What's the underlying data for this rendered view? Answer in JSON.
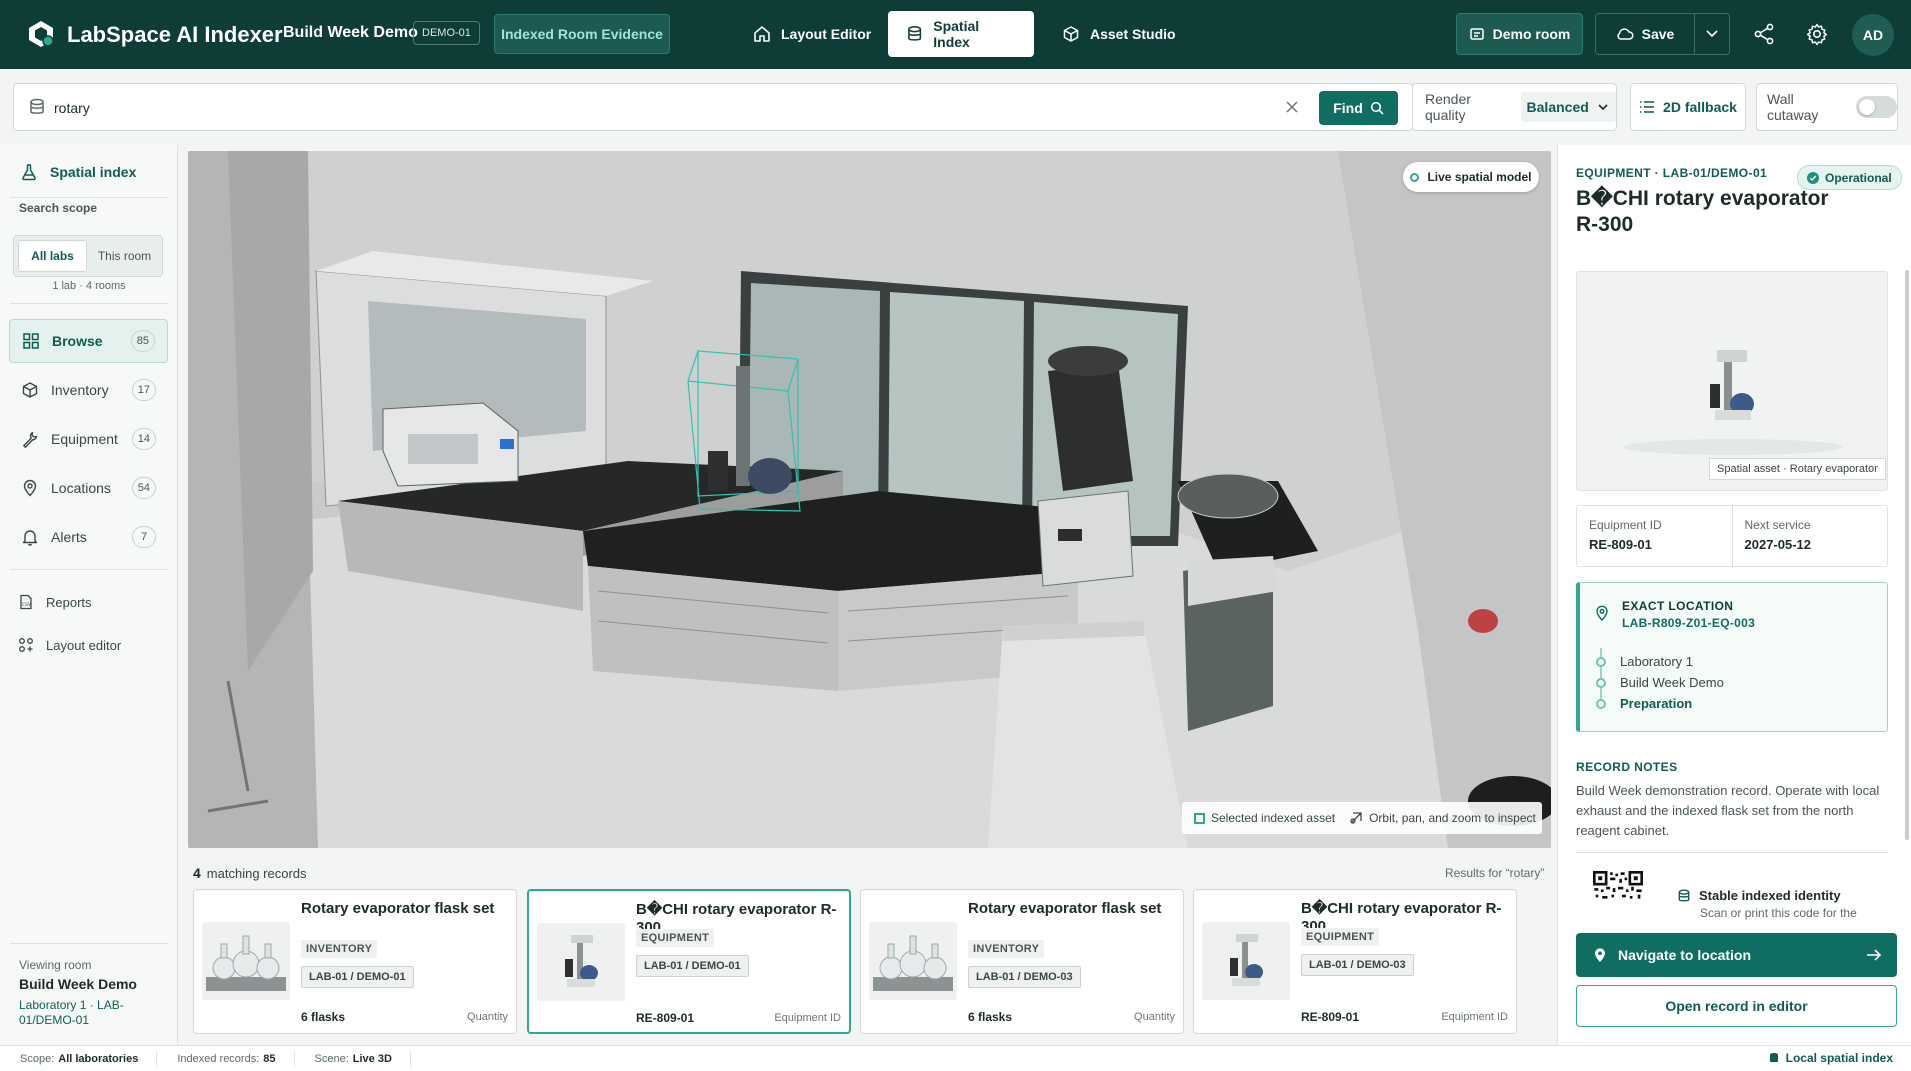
{
  "app": {
    "title": "LabSpace AI Indexer",
    "project": "Build Week Demo",
    "project_badge": "DEMO-01",
    "evidence_button": "Indexed Room Evidence",
    "avatar": "AD",
    "colors": {
      "brand": "#0e3d38",
      "accent": "#0f6d62",
      "highlight": "#2ea793"
    }
  },
  "nav": {
    "tabs": [
      {
        "label": "Layout Editor",
        "icon": "home-icon"
      },
      {
        "label": "Spatial Index",
        "icon": "database-icon",
        "active": true
      },
      {
        "label": "Asset Studio",
        "icon": "cube-icon"
      }
    ],
    "demo_room": "Demo room",
    "save": "Save"
  },
  "search": {
    "value": "rotary",
    "find_label": "Find",
    "quality_label": "Render quality",
    "quality_value": "Balanced",
    "fallback_label": "2D fallback",
    "cutaway_label": "Wall cutaway",
    "cutaway_on": false
  },
  "sidebar": {
    "title": "Spatial index",
    "scope_label": "Search scope",
    "scope_options": [
      "All labs",
      "This room"
    ],
    "scope_meta": "1 lab · 4 rooms",
    "items": [
      {
        "label": "Browse",
        "count": "85",
        "icon": "grid-icon",
        "active": true
      },
      {
        "label": "Inventory",
        "count": "17",
        "icon": "box-icon"
      },
      {
        "label": "Equipment",
        "count": "14",
        "icon": "wrench-icon"
      },
      {
        "label": "Locations",
        "count": "54",
        "icon": "pin-icon"
      },
      {
        "label": "Alerts",
        "count": "7",
        "icon": "bell-icon"
      }
    ],
    "sub_items": [
      {
        "label": "Reports",
        "icon": "csv-icon"
      },
      {
        "label": "Layout editor",
        "icon": "layout-icon"
      }
    ],
    "viewing_label": "Viewing room",
    "viewing_room": "Build Week Demo",
    "viewing_path": "Laboratory 1 · LAB-01/DEMO-01"
  },
  "viewport": {
    "live_label": "Live spatial model",
    "legend_selected": "Selected indexed asset",
    "legend_hint": "Orbit, pan, and zoom to inspect"
  },
  "results": {
    "count": "4",
    "count_label": "matching records",
    "query_note": "Results for “rotary”",
    "cards": [
      {
        "title": "Rotary evaporator flask set",
        "category": "INVENTORY",
        "location": "LAB-01 / DEMO-01",
        "value": "6 flasks",
        "key": "Quantity",
        "thumb": "flask-set"
      },
      {
        "title": "B�CHI rotary evaporator R-300",
        "category": "EQUIPMENT",
        "location": "LAB-01 / DEMO-01",
        "value": "RE-809-01",
        "key": "Equipment ID",
        "thumb": "evaporator",
        "active": true
      },
      {
        "title": "Rotary evaporator flask set",
        "category": "INVENTORY",
        "location": "LAB-01 / DEMO-03",
        "value": "6 flasks",
        "key": "Quantity",
        "thumb": "flask-set"
      },
      {
        "title": "B�CHI rotary evaporator R-300",
        "category": "EQUIPMENT",
        "location": "LAB-01 / DEMO-03",
        "value": "RE-809-01",
        "key": "Equipment ID",
        "thumb": "evaporator"
      }
    ]
  },
  "detail": {
    "category": "EQUIPMENT · LAB-01/DEMO-01",
    "status": "Operational",
    "title": "B�CHI rotary evaporator R-300",
    "image_caption": "Spatial asset · Rotary evaporator",
    "equipment_id_label": "Equipment ID",
    "equipment_id": "RE-809-01",
    "next_service_label": "Next service",
    "next_service": "2027-05-12",
    "location_heading": "EXACT LOCATION",
    "location_code": "LAB-R809-Z01-EQ-003",
    "location_path": [
      "Laboratory 1",
      "Build Week Demo",
      "Preparation"
    ],
    "notes_heading": "RECORD NOTES",
    "notes": "Build Week demonstration record. Operate with local exhaust and the indexed flask set from the north reagent cabinet.",
    "identity_title": "Stable indexed identity",
    "identity_sub": "Scan or print this code for the",
    "navigate": "Navigate to location",
    "open_editor": "Open record in editor"
  },
  "status": {
    "scope_label": "Scope:",
    "scope_value": "All laboratories",
    "records_label": "Indexed records:",
    "records_value": "85",
    "scene_label": "Scene:",
    "scene_value": "Live 3D",
    "local": "Local spatial index"
  }
}
